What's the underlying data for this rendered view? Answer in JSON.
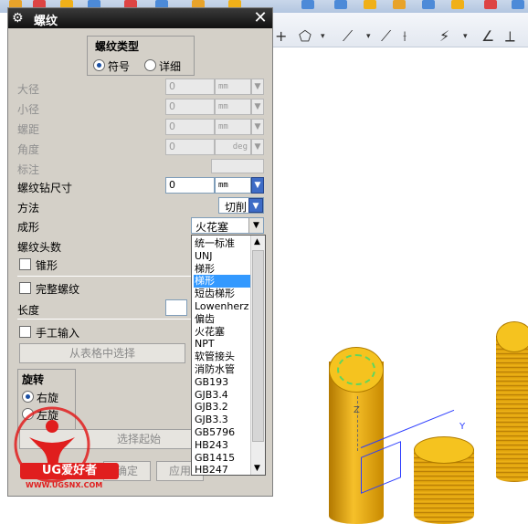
{
  "dialog": {
    "title": "螺纹",
    "close_symbol": "✕",
    "thread_type": {
      "title": "螺纹类型",
      "options": [
        "符号",
        "详细"
      ],
      "selected": "符号"
    },
    "fields": {
      "major_dia": {
        "label": "大径",
        "value": "0",
        "unit": "mm"
      },
      "minor_dia": {
        "label": "小径",
        "value": "0",
        "unit": "mm"
      },
      "pitch": {
        "label": "螺距",
        "value": "0",
        "unit": "mm"
      },
      "angle": {
        "label": "角度",
        "value": "0",
        "unit": "deg"
      },
      "callout": {
        "label": "标注"
      },
      "tap_drill": {
        "label": "螺纹钻尺寸",
        "value": "0",
        "unit": "mm"
      }
    },
    "method": {
      "label": "方法",
      "value": "切削"
    },
    "form": {
      "label": "成形",
      "value": "火花塞",
      "options": [
        "统一标准",
        "UNJ",
        "梯形",
        "梯形",
        "短齿梯形",
        "Lowenherz",
        "偏齿",
        "火花塞",
        "NPT",
        "软管接头",
        "消防水管",
        "GB193",
        "GJB3.4",
        "GJB3.2",
        "GJB3.3",
        "GB5796",
        "HB243",
        "GB1415",
        "HB247"
      ],
      "highlighted_index": 3
    },
    "starts": {
      "label": "螺纹头数"
    },
    "tapered": {
      "label": "锥形"
    },
    "full_thread": {
      "label": "完整螺纹"
    },
    "length": {
      "label": "长度"
    },
    "manual_input": {
      "label": "手工输入"
    },
    "from_table_button": "从表格中选择",
    "rotation": {
      "title": "旋转",
      "options": [
        "右旋",
        "左旋"
      ],
      "selected": "右旋"
    },
    "select_start_button": "选择起始",
    "ok_button": "确定",
    "apply_button": "应用"
  },
  "watermark": {
    "brand": "UG爱好者",
    "url": "WWW.UGSNX.COM"
  },
  "viewport": {
    "axis_z": "Z",
    "axis_y": "Y"
  },
  "colors": {
    "title_bar": "#1a1a1a",
    "dialog_bg": "#d4d0c8",
    "selection": "#3399ff",
    "cylinder": "#f0b418"
  }
}
